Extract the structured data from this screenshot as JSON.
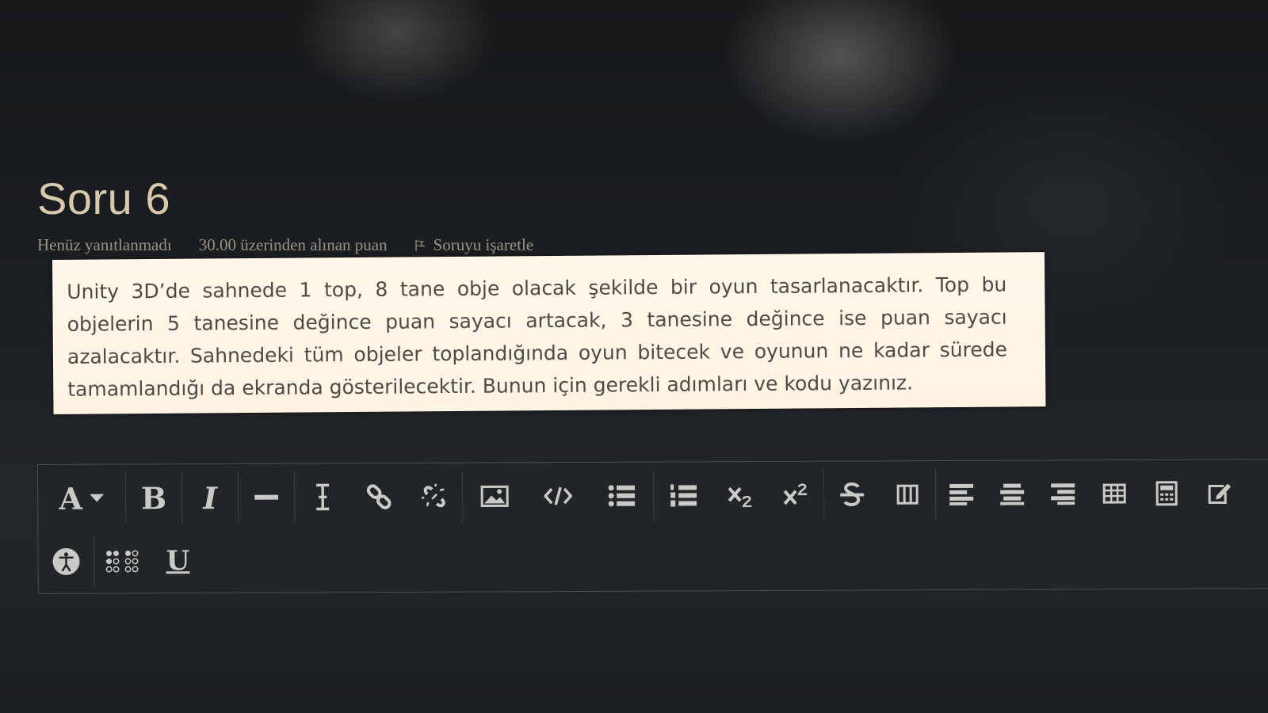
{
  "question": {
    "title": "Soru 6",
    "status": "Henüz yanıtlanmadı",
    "grade": "30.00 üzerinden alınan puan",
    "flag_label": "Soruyu işaretle",
    "text": "Unity 3D’de sahnede 1 top, 8 tane obje olacak şekilde bir oyun tasarlanacaktır. Top bu objelerin 5 tanesine değince puan sayacı artacak, 3 tanesine değince ise puan sayacı azalacaktır. Sahnedeki tüm objeler toplandığında oyun bitecek ve oyunun ne kadar sürede tamamlandığı da ekranda gösterilecektir. Bunun için gerekli adımları ve kodu yazınız."
  },
  "toolbar": {
    "font_label": "A",
    "bold_label": "B",
    "italic_label": "I",
    "underline_label": "U",
    "icons": [
      "font-dropdown-icon",
      "bold-icon",
      "italic-icon",
      "horizontal-rule-icon",
      "clear-formatting-icon",
      "link-icon",
      "unlink-icon",
      "image-icon",
      "code-icon",
      "bullet-list-icon",
      "numbered-list-icon",
      "subscript-icon",
      "superscript-icon",
      "strikethrough-icon",
      "table-columns-icon",
      "align-left-icon",
      "align-center-icon",
      "align-right-icon",
      "table-icon",
      "calculator-icon",
      "edit-icon",
      "accessibility-icon",
      "braille-icon",
      "underline-icon"
    ]
  },
  "colors": {
    "background": "#1e2123",
    "title": "#d8c9ad",
    "meta_text": "#9a9284",
    "question_box": "#fff5e7",
    "question_text": "#4f4a45",
    "toolbar_icon": "#c9c9c6"
  }
}
